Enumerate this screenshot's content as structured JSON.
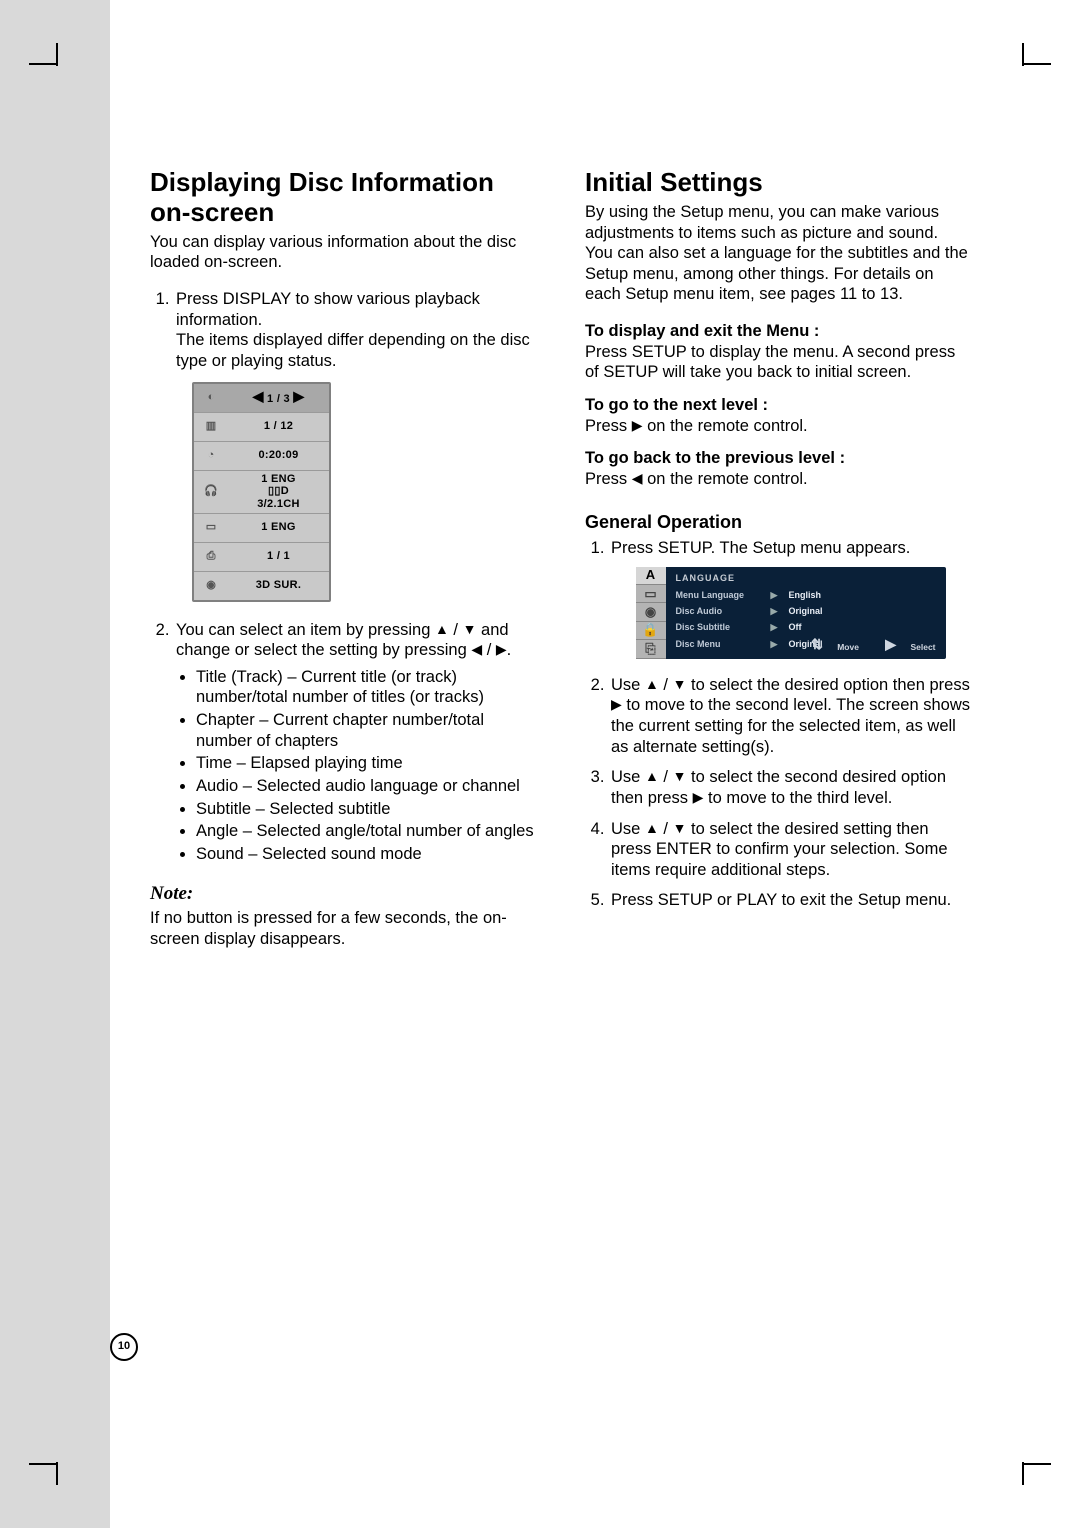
{
  "page_number": "10",
  "symbols": {
    "up": "▲",
    "down": "▼",
    "left": "◀",
    "right": "▶",
    "updown": "⇅"
  },
  "left": {
    "heading": "Displaying Disc Information on-screen",
    "intro": "You can display various information about the disc loaded on-screen.",
    "step1_a": "Press DISPLAY to show various playback information.",
    "step1_b": "The items displayed differ depending on the disc type or playing status.",
    "osd": [
      {
        "icon": "disc-icon",
        "value": "1 / 3",
        "selected": true,
        "nav": true
      },
      {
        "icon": "title-icon",
        "value": "1 / 12"
      },
      {
        "icon": "clock-icon",
        "value": "0:20:09"
      },
      {
        "icon": "audio-icon",
        "value": "1 ENG\n▯▯D\n3/2.1CH",
        "tall": true
      },
      {
        "icon": "subtitle-icon",
        "value": "1 ENG"
      },
      {
        "icon": "angle-icon",
        "value": "1 / 1"
      },
      {
        "icon": "sound-icon",
        "value": "3D SUR."
      }
    ],
    "step2_a": "You can select an item by pressing ",
    "step2_b": " and change or select the setting by pressing ",
    "step2_c": ".",
    "bullets": [
      "Title (Track) – Current title (or track) number/total number of titles (or tracks)",
      "Chapter – Current chapter number/total number of chapters",
      "Time – Elapsed playing time",
      "Audio – Selected audio language or channel",
      "Subtitle – Selected subtitle",
      "Angle – Selected angle/total number of angles",
      "Sound – Selected sound mode"
    ],
    "note_h": "Note:",
    "note_body": "If no button is pressed for a few seconds, the on-screen display disappears."
  },
  "right": {
    "heading": "Initial Settings",
    "intro": "By using the Setup menu, you can make various adjustments to items such as picture and sound. You can also set a language for the subtitles and the Setup menu, among other things. For details on each Setup menu item, see pages 11 to 13.",
    "h_display": "To display and exit the Menu :",
    "p_display": "Press SETUP to display the menu. A second press of SETUP will take you back to initial screen.",
    "h_next": "To go to the next level :",
    "p_next_a": "Press ",
    "p_next_b": " on the remote control.",
    "h_prev": "To go back to the previous level :",
    "p_prev_a": "Press ",
    "p_prev_b": " on the remote control.",
    "gen_h": "General Operation",
    "gen_1": "Press SETUP. The Setup menu appears.",
    "setup": {
      "tab_title": "LANGUAGE",
      "rows": [
        {
          "label": "Menu Language",
          "value": "English"
        },
        {
          "label": "Disc Audio",
          "value": "Original"
        },
        {
          "label": "Disc Subtitle",
          "value": "Off"
        },
        {
          "label": "Disc Menu",
          "value": "Original"
        }
      ],
      "foot_move": "Move",
      "foot_select": "Select"
    },
    "gen_2_a": "Use ",
    "gen_2_b": " to select the desired option then press ",
    "gen_2_c": " to move to the second level. The screen shows the current setting for the selected item, as well as alternate setting(s).",
    "gen_3_a": "Use ",
    "gen_3_b": " to select the second desired option then press ",
    "gen_3_c": " to move to the third level.",
    "gen_4_a": "Use ",
    "gen_4_b": " to select the desired setting then press ENTER to confirm your selection. Some items require additional steps.",
    "gen_5": "Press SETUP or PLAY to exit the Setup menu."
  }
}
